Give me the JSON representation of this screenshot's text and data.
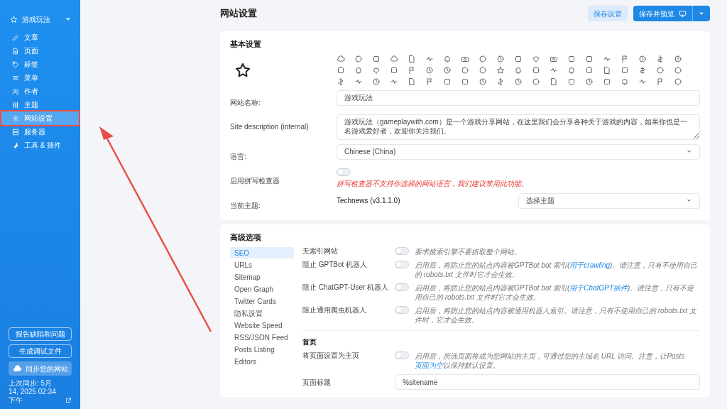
{
  "sidebar": {
    "site_title": "游戏玩法",
    "items": [
      {
        "kind": "pen",
        "label": "文章",
        "selected": false
      },
      {
        "kind": "file",
        "label": "页面",
        "selected": false
      },
      {
        "kind": "tag",
        "label": "标签",
        "selected": false
      },
      {
        "kind": "menu",
        "label": "菜单",
        "selected": false
      },
      {
        "kind": "users",
        "label": "作者",
        "selected": false
      },
      {
        "kind": "sliders",
        "label": "主题",
        "selected": false
      },
      {
        "kind": "gear",
        "label": "网站设置",
        "selected": true
      },
      {
        "kind": "server",
        "label": "服务器",
        "selected": false
      },
      {
        "kind": "wrench",
        "label": "工具 & 插件",
        "selected": false
      }
    ],
    "buttons": [
      "报告缺陷和问题",
      "生成调试文件"
    ],
    "sync_button": "同步您的网站",
    "last_sync": "上次同步: 5月 14, 2025 02:34 下午"
  },
  "header": {
    "title": "网站设置",
    "save_button": "保存设置",
    "save_preview_button": "保存并预览"
  },
  "basic": {
    "title": "基本设置",
    "fields": [
      {
        "kind": "text",
        "label": "网站名称:",
        "value": "游戏玩法"
      },
      {
        "kind": "textarea",
        "label": "Site description (internal)",
        "value": "游戏玩法（gameplaywith.com）是一个游戏分享网站，在这里我们会分享各种关于游戏的内容，如果你也是一名游戏爱好者，欢迎你关注我们。"
      },
      {
        "kind": "select",
        "label": "语言:",
        "value": "Chinese (China)"
      },
      {
        "kind": "toggle",
        "label": "启用拼写检查器",
        "on": false,
        "note": "拼写检查器不支持你选择的网站语言，我们建议禁用此功能。"
      },
      {
        "kind": "theme",
        "label": "当前主题:",
        "value": "Technews (v3.1.1.0)",
        "select": "选择主题"
      }
    ]
  },
  "advanced": {
    "title": "高级选项",
    "nav": [
      {
        "label": "SEO",
        "selected": true
      },
      {
        "label": "URLs",
        "selected": false
      },
      {
        "label": "Sitemap",
        "selected": false
      },
      {
        "label": "Open Graph",
        "selected": false
      },
      {
        "label": "Twitter Cards",
        "selected": false
      },
      {
        "label": "隐私设置",
        "selected": false
      },
      {
        "label": "Website Speed",
        "selected": false
      },
      {
        "label": "RSS/JSON Feed",
        "selected": false
      },
      {
        "label": "Posts Listing",
        "selected": false
      },
      {
        "label": "Editors",
        "selected": false
      }
    ],
    "options": [
      {
        "label": "无索引网站",
        "on": false,
        "help": [
          {
            "kind": "plain",
            "text": "要求搜索引擎不要抓取整个网站。"
          }
        ]
      },
      {
        "label": "阻止 GPTBot 机器人",
        "on": false,
        "help": [
          {
            "kind": "plain",
            "text": "启用后，将防止您的站点内容被GPTBot bot 索引("
          },
          {
            "kind": "link",
            "text": "用于crawling"
          },
          {
            "kind": "plain",
            "text": ")。请注意，只有不使用自己的 robots.txt 文件时它才会生效。"
          }
        ]
      },
      {
        "label": "阻止 ChatGPT-User 机器人",
        "on": false,
        "help": [
          {
            "kind": "plain",
            "text": "启用后，将防止您的站点内容被GPTBot bot 索引("
          },
          {
            "kind": "link",
            "text": "用于ChatGPT插件"
          },
          {
            "kind": "plain",
            "text": ")。请注意，只有不使用自己的 robots.txt 文件时它才会生效。"
          }
        ]
      },
      {
        "label": "阻止通用爬虫机器人",
        "on": false,
        "help": [
          {
            "kind": "plain",
            "text": "启用后，将防止您的站点内容被通用机器人索引。请注意，只有不使用自己的 robots.txt 文件时，它才会生效。"
          }
        ]
      }
    ],
    "homepage": {
      "title": "首页",
      "options": [
        {
          "label": "将页面设置为主页",
          "on": false,
          "help": [
            {
              "kind": "plain",
              "text": "启用后，所选页面将成为您网站的主页，可通过您的主域名 URL 访问。注意，让Posts "
            },
            {
              "kind": "link",
              "text": "页面为空"
            },
            {
              "kind": "plain",
              "text": "以保持默认设置。"
            }
          ]
        }
      ],
      "page_title": {
        "label": "页面标题",
        "value": "%sitename"
      }
    }
  }
}
